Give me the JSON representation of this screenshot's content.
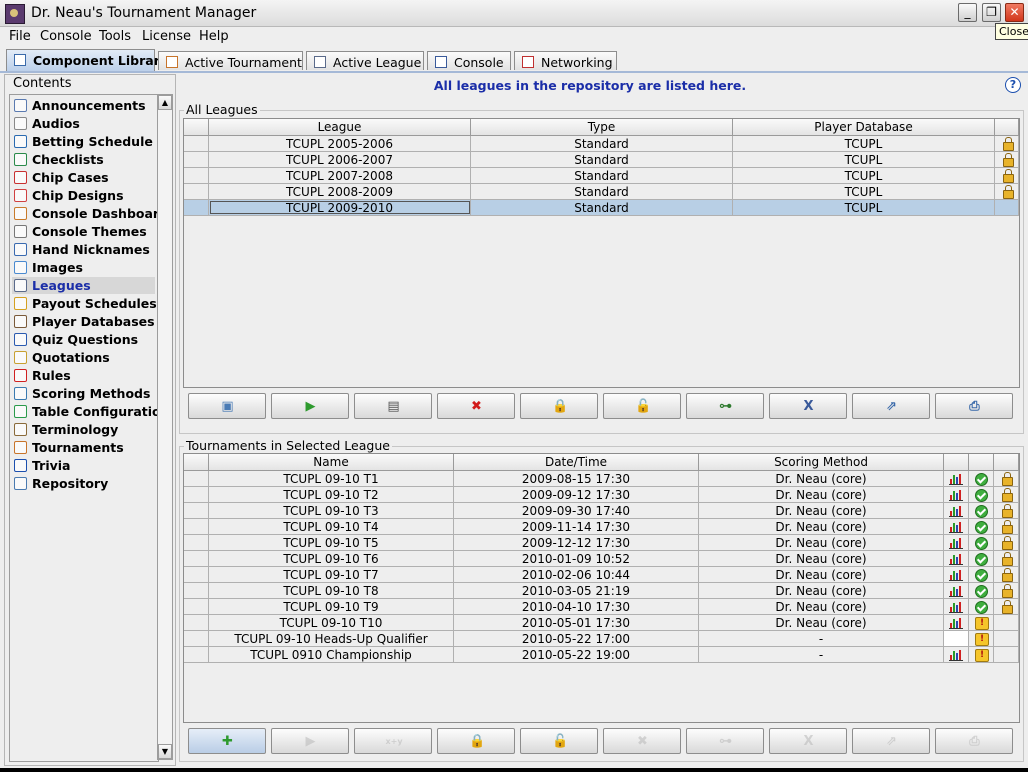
{
  "window": {
    "title": "Dr. Neau's Tournament Manager",
    "tooltip": "Close"
  },
  "menu": [
    "File",
    "Console",
    "Tools",
    "License",
    "Help"
  ],
  "tabs": [
    {
      "label": "Component Library",
      "icon": "library-icon",
      "active": true
    },
    {
      "label": "Active Tournament",
      "icon": "table-grid-icon",
      "active": false
    },
    {
      "label": "Active League",
      "icon": "league-icon",
      "active": false
    },
    {
      "label": "Console",
      "icon": "monitor-icon",
      "active": false
    },
    {
      "label": "Networking",
      "icon": "network-icon",
      "active": false
    }
  ],
  "sidebar": {
    "label": "Contents",
    "items": [
      {
        "label": "Announcements",
        "icon": "megaphone-icon"
      },
      {
        "label": "Audios",
        "icon": "speaker-icon"
      },
      {
        "label": "Betting Schedule",
        "icon": "schedule-icon"
      },
      {
        "label": "Checklists",
        "icon": "checklist-icon"
      },
      {
        "label": "Chip Cases",
        "icon": "chip-case-icon"
      },
      {
        "label": "Chip Designs",
        "icon": "chip-design-icon"
      },
      {
        "label": "Console Dashboards",
        "icon": "dashboard-icon"
      },
      {
        "label": "Console Themes",
        "icon": "theme-icon"
      },
      {
        "label": "Hand Nicknames",
        "icon": "cards-icon"
      },
      {
        "label": "Images",
        "icon": "image-icon"
      },
      {
        "label": "Leagues",
        "icon": "league-icon",
        "selected": true
      },
      {
        "label": "Payout Schedules",
        "icon": "trophy-icon"
      },
      {
        "label": "Player Databases",
        "icon": "players-icon"
      },
      {
        "label": "Quiz Questions",
        "icon": "question-icon"
      },
      {
        "label": "Quotations",
        "icon": "speech-bubble-icon"
      },
      {
        "label": "Rules",
        "icon": "exclamation-icon"
      },
      {
        "label": "Scoring Methods",
        "icon": "formula-icon"
      },
      {
        "label": "Table Configurations",
        "icon": "poker-table-icon"
      },
      {
        "label": "Terminology",
        "icon": "book-icon"
      },
      {
        "label": "Tournaments",
        "icon": "table-grid-icon"
      },
      {
        "label": "Trivia",
        "icon": "info-icon"
      },
      {
        "label": "Repository",
        "icon": "database-icon"
      }
    ]
  },
  "main": {
    "info": "All leagues in the repository are listed here.",
    "leagues": {
      "title": "All Leagues",
      "columns": [
        "League",
        "Type",
        "Player Database"
      ],
      "rows": [
        {
          "league": "TCUPL 2005-2006",
          "type": "Standard",
          "db": "TCUPL",
          "locked": true
        },
        {
          "league": "TCUPL 2006-2007",
          "type": "Standard",
          "db": "TCUPL",
          "locked": true
        },
        {
          "league": "TCUPL 2007-2008",
          "type": "Standard",
          "db": "TCUPL",
          "locked": true
        },
        {
          "league": "TCUPL 2008-2009",
          "type": "Standard",
          "db": "TCUPL",
          "locked": true
        },
        {
          "league": "TCUPL 2009-2010",
          "type": "Standard",
          "db": "TCUPL",
          "locked": false,
          "selected": true
        }
      ],
      "toolbar": [
        {
          "name": "new-league-button",
          "icon": "new-doc-icon",
          "glyph": "▣",
          "color": "#4a7bb5",
          "enabled": true
        },
        {
          "name": "run-league-button",
          "icon": "play-icon",
          "glyph": "▶",
          "color": "#2e9a2e",
          "enabled": true
        },
        {
          "name": "edit-league-button",
          "icon": "edit-doc-icon",
          "glyph": "▤",
          "color": "#555555",
          "enabled": true
        },
        {
          "name": "delete-league-button",
          "icon": "delete-icon",
          "glyph": "✖",
          "color": "#d11b1b",
          "enabled": true
        },
        {
          "name": "lock-league-button",
          "icon": "lock-icon",
          "glyph": "🔒",
          "color": "#c99a1a",
          "enabled": true
        },
        {
          "name": "unlock-league-button",
          "icon": "unlock-icon",
          "glyph": "🔓",
          "color": "#c99a1a",
          "enabled": true
        },
        {
          "name": "tree-league-button",
          "icon": "tree-icon",
          "glyph": "⊶",
          "color": "#2e7a2e",
          "enabled": true
        },
        {
          "name": "excel-league-button",
          "icon": "spreadsheet-icon",
          "glyph": "X",
          "color": "#3a5a9a",
          "enabled": true
        },
        {
          "name": "export-league-button",
          "icon": "export-icon",
          "glyph": "⇗",
          "color": "#3a6aaa",
          "enabled": true
        },
        {
          "name": "print-league-button",
          "icon": "print-icon",
          "glyph": "⎙",
          "color": "#3a6aaa",
          "enabled": true
        }
      ]
    },
    "tournaments": {
      "title": "Tournaments in Selected League",
      "columns": [
        "Name",
        "Date/Time",
        "Scoring Method"
      ],
      "sort_indicator": "▴",
      "rows": [
        {
          "name": "TCUPL 09-10 T1",
          "datetime": "2009-08-15 17:30",
          "method": "Dr. Neau (core)",
          "chart": true,
          "status": "ok",
          "locked": true
        },
        {
          "name": "TCUPL 09-10 T2",
          "datetime": "2009-09-12 17:30",
          "method": "Dr. Neau (core)",
          "chart": true,
          "status": "ok",
          "locked": true
        },
        {
          "name": "TCUPL 09-10 T3",
          "datetime": "2009-09-30 17:40",
          "method": "Dr. Neau (core)",
          "chart": true,
          "status": "ok",
          "locked": true
        },
        {
          "name": "TCUPL 09-10 T4",
          "datetime": "2009-11-14 17:30",
          "method": "Dr. Neau (core)",
          "chart": true,
          "status": "ok",
          "locked": true
        },
        {
          "name": "TCUPL 09-10 T5",
          "datetime": "2009-12-12 17:30",
          "method": "Dr. Neau (core)",
          "chart": true,
          "status": "ok",
          "locked": true
        },
        {
          "name": "TCUPL 09-10 T6",
          "datetime": "2010-01-09 10:52",
          "method": "Dr. Neau (core)",
          "chart": true,
          "status": "ok",
          "locked": true
        },
        {
          "name": "TCUPL 09-10 T7",
          "datetime": "2010-02-06 10:44",
          "method": "Dr. Neau (core)",
          "chart": true,
          "status": "ok",
          "locked": true
        },
        {
          "name": "TCUPL 09-10 T8",
          "datetime": "2010-03-05 21:19",
          "method": "Dr. Neau (core)",
          "chart": true,
          "status": "ok",
          "locked": true
        },
        {
          "name": "TCUPL 09-10 T9",
          "datetime": "2010-04-10 17:30",
          "method": "Dr. Neau (core)",
          "chart": true,
          "status": "ok",
          "locked": true
        },
        {
          "name": "TCUPL 09-10 T10",
          "datetime": "2010-05-01 17:30",
          "method": "Dr. Neau (core)",
          "chart": true,
          "status": "warn",
          "locked": false
        },
        {
          "name": "TCUPL 09-10 Heads-Up Qualifier",
          "datetime": "2010-05-22 17:00",
          "method": "-",
          "chart": false,
          "status": "warn",
          "locked": false
        },
        {
          "name": "TCUPL 0910 Championship",
          "datetime": "2010-05-22 19:00",
          "method": "-",
          "chart": true,
          "status": "warn",
          "locked": false
        }
      ],
      "toolbar": [
        {
          "name": "add-tournament-button",
          "icon": "add-icon",
          "glyph": "✚",
          "color": "#2e9a2e",
          "enabled": true,
          "hl": true
        },
        {
          "name": "run-tournament-button",
          "icon": "play-icon",
          "glyph": "▶",
          "color": "#2e9a2e",
          "enabled": false
        },
        {
          "name": "scoring-tournament-button",
          "icon": "formula-icon",
          "glyph": "x+y",
          "color": "#555555",
          "enabled": false
        },
        {
          "name": "lock-tournament-button",
          "icon": "lock-icon",
          "glyph": "🔒",
          "color": "#c99a1a",
          "enabled": true
        },
        {
          "name": "unlock-tournament-button",
          "icon": "unlock-icon",
          "glyph": "🔓",
          "color": "#c99a1a",
          "enabled": true
        },
        {
          "name": "delete-tournament-button",
          "icon": "delete-icon",
          "glyph": "✖",
          "color": "#d11b1b",
          "enabled": false
        },
        {
          "name": "tree-tournament-button",
          "icon": "tree-icon",
          "glyph": "⊶",
          "color": "#2e7a2e",
          "enabled": false
        },
        {
          "name": "excel-tournament-button",
          "icon": "spreadsheet-icon",
          "glyph": "X",
          "color": "#3a5a9a",
          "enabled": false
        },
        {
          "name": "export-tournament-button",
          "icon": "export-icon",
          "glyph": "⇗",
          "color": "#3a6aaa",
          "enabled": false
        },
        {
          "name": "print-tournament-button",
          "icon": "print-icon",
          "glyph": "⎙",
          "color": "#3a6aaa",
          "enabled": false
        }
      ]
    }
  }
}
